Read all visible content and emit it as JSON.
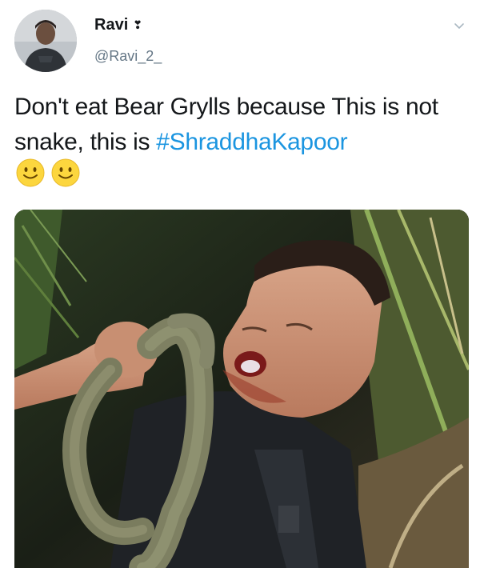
{
  "tweet": {
    "author": {
      "display_name": "Ravi",
      "name_emoji": "❣",
      "handle": "@Ravi_2_",
      "avatar": "user-avatar-photo"
    },
    "menu_icon": "chevron-down-icon",
    "text_part1": "Don't eat Bear Grylls because This is not snake, this is ",
    "hashtag": "#ShraddhaKapoor",
    "emojis": [
      "slightly-smiling-face",
      "slightly-smiling-face"
    ],
    "media": {
      "description_icon": "photo-man-holding-snake"
    },
    "colors": {
      "hashtag": "#1b95e0",
      "handle": "#657786",
      "text": "#14171a"
    }
  }
}
